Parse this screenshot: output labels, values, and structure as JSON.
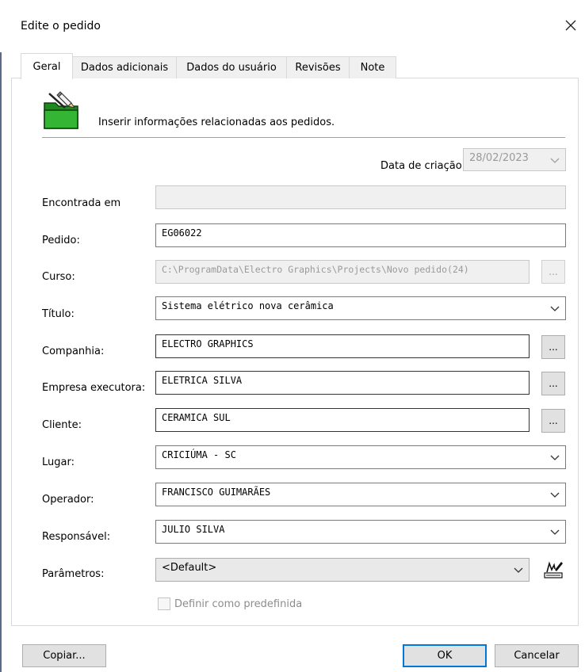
{
  "window": {
    "title": "Edite o pedido"
  },
  "tabs": [
    {
      "label": "Geral",
      "active": true
    },
    {
      "label": "Dados adicionais"
    },
    {
      "label": "Dados do usuário"
    },
    {
      "label": "Revisões"
    },
    {
      "label": "Note"
    }
  ],
  "header": {
    "text": "Inserir informações relacionadas aos pedidos.",
    "icon": "folder-edit-icon"
  },
  "creation_date": {
    "label": "Data de criação",
    "value": "28/02/2023"
  },
  "fields": {
    "found_in": {
      "label": "Encontrada em",
      "value": ""
    },
    "order": {
      "label": "Pedido:",
      "value": "EG06022"
    },
    "path": {
      "label": "Curso:",
      "value": "C:\\ProgramData\\Electro Graphics\\Projects\\Novo pedido(24)"
    },
    "title": {
      "label": "Título:",
      "value": "Sistema elétrico nova cerâmica"
    },
    "company": {
      "label": "Companhia:",
      "value": "ELECTRO GRAPHICS"
    },
    "contractor": {
      "label": "Empresa executora:",
      "value": "ELETRICA SILVA"
    },
    "client": {
      "label": "Cliente:",
      "value": "CERAMICA SUL"
    },
    "place": {
      "label": "Lugar:",
      "value": "CRICIÚMA - SC"
    },
    "operator": {
      "label": "Operador:",
      "value": "FRANCISCO GUIMARÃES"
    },
    "responsible": {
      "label": "Responsável:",
      "value": "JULIO SILVA"
    },
    "parameters": {
      "label": "Parâmetros:",
      "value": "<Default>"
    }
  },
  "ellipsis": "...",
  "checkbox": {
    "label": "Definir como predefinida",
    "checked": false
  },
  "buttons": {
    "copy": "Copiar...",
    "ok": "OK",
    "cancel": "Cancelar"
  },
  "colors": {
    "folder_green": "#2ea62e",
    "default_button_border": "#0078d7"
  }
}
